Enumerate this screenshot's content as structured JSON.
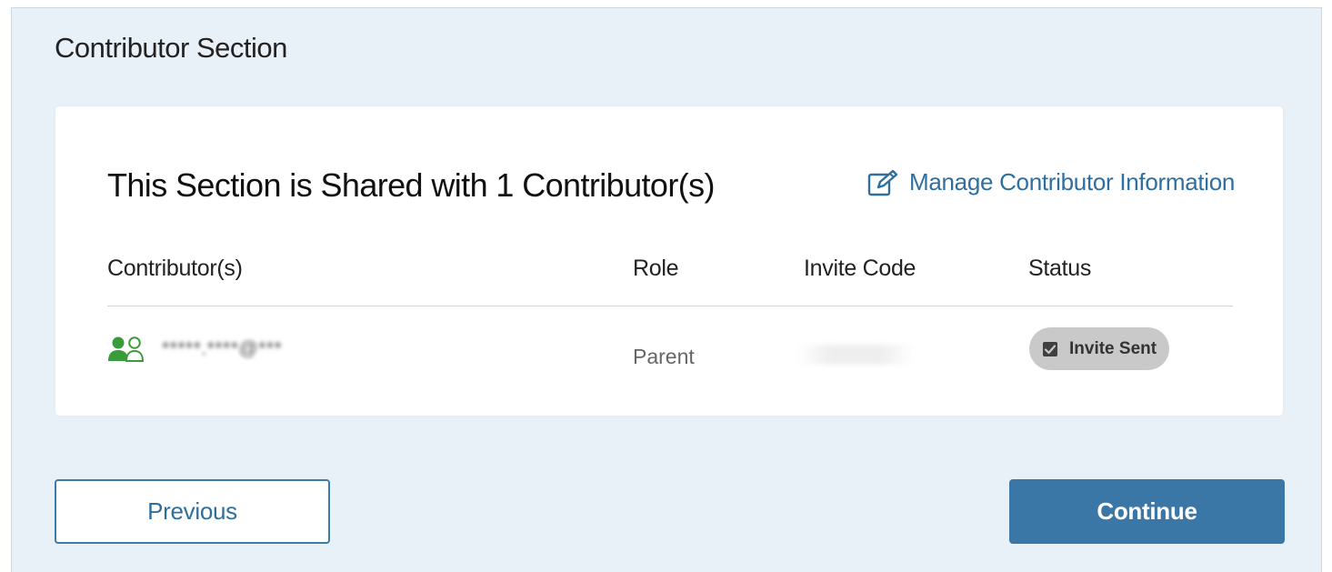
{
  "section": {
    "title": "Contributor Section"
  },
  "card": {
    "heading": "This Section is Shared with 1 Contributor(s)",
    "manage_link": {
      "label": "Manage Contributor Information",
      "icon": "edit-icon"
    },
    "columns": [
      "Contributor(s)",
      "Role",
      "Invite Code",
      "Status"
    ],
    "rows": [
      {
        "contributor": "*****.****@***",
        "contributor_icon": "users-icon",
        "role": "Parent",
        "invite_code": "",
        "status": "Invite Sent",
        "status_icon": "checkbox-icon"
      }
    ]
  },
  "buttons": {
    "previous": "Previous",
    "continue": "Continue"
  },
  "colors": {
    "accent": "#3b77a6",
    "link": "#2e6f9e",
    "icon_green": "#3a9b3a",
    "panel_bg": "#e8f1f8"
  }
}
